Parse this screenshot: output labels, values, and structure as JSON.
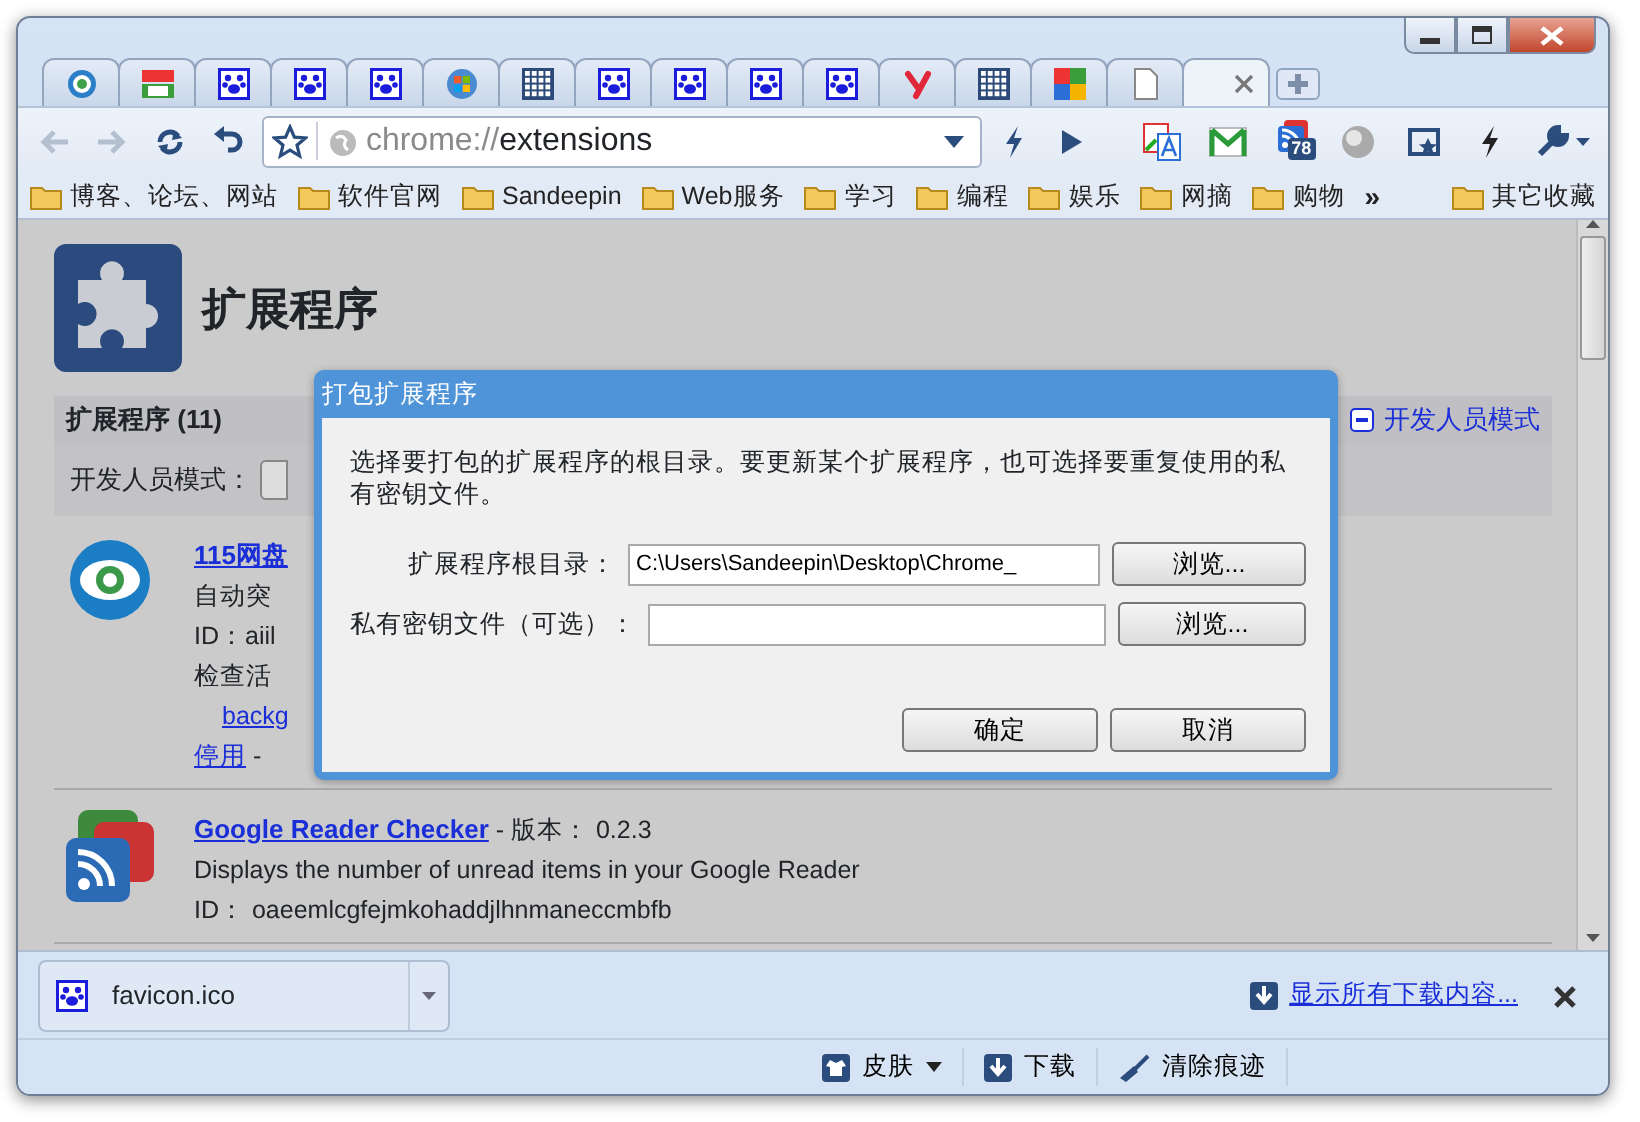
{
  "tabs": [
    {
      "kind": "ring",
      "selected": false
    },
    {
      "kind": "colorful",
      "selected": false
    },
    {
      "kind": "paw",
      "selected": false
    },
    {
      "kind": "paw",
      "selected": false
    },
    {
      "kind": "paw",
      "selected": false
    },
    {
      "kind": "windows",
      "selected": false
    },
    {
      "kind": "grid",
      "selected": false
    },
    {
      "kind": "paw",
      "selected": false
    },
    {
      "kind": "paw",
      "selected": false
    },
    {
      "kind": "paw",
      "selected": false
    },
    {
      "kind": "paw",
      "selected": false
    },
    {
      "kind": "y",
      "selected": false
    },
    {
      "kind": "grid",
      "selected": false
    },
    {
      "kind": "quad",
      "selected": false
    },
    {
      "kind": "page",
      "selected": false
    },
    {
      "kind": "none",
      "selected": true
    }
  ],
  "nav_buttons": [
    {
      "kind": "back",
      "disabled": true
    },
    {
      "kind": "forward",
      "disabled": true
    },
    {
      "kind": "reload",
      "disabled": false
    },
    {
      "kind": "undo",
      "disabled": false
    }
  ],
  "address": {
    "scheme": "chrome://",
    "path": "extensions"
  },
  "extension_buttons": [
    {
      "kind": "translate"
    },
    {
      "kind": "mail"
    },
    {
      "kind": "rss",
      "badge": "78"
    },
    {
      "kind": "globe"
    },
    {
      "kind": "star"
    },
    {
      "kind": "bolt"
    },
    {
      "kind": "wrench"
    }
  ],
  "bookmarks": [
    "博客、论坛、网站",
    "软件官网",
    "Sandeepin",
    "Web服务",
    "学习",
    "编程",
    "娱乐",
    "网摘",
    "购物"
  ],
  "bookmarks_overflow": "»",
  "other_bookmarks": "其它收藏",
  "page": {
    "title": "扩展程序",
    "section_title": "扩展程序 (11)",
    "dev_mode_link": "开发人员模式",
    "dev_mode_label": "开发人员模式：",
    "extensions": [
      {
        "kind": "eye",
        "name": "115网盘",
        "lines": [
          "自动突",
          "ID：aiil",
          "检查活"
        ],
        "view_link": "backg",
        "actions": [
          "停用",
          "-"
        ]
      },
      {
        "kind": "rss",
        "name": "Google Reader Checker",
        "meta": " - 版本： 0.2.3",
        "lines": [
          "Displays the number of unread items in your Google Reader",
          "ID： oaeemlcgfejmkohaddjlhnmaneccmbfb"
        ]
      }
    ]
  },
  "dialog": {
    "title": "打包扩展程序",
    "message": "选择要打包的扩展程序的根目录。要更新某个扩展程序，也可选择要重复使用的私有密钥文件。",
    "fields": [
      {
        "label": "扩展程序根目录：",
        "value": "C:\\Users\\Sandeepin\\Desktop\\Chrome_",
        "button": "浏览..."
      },
      {
        "label": "私有密钥文件（可选）：",
        "button": "浏览..."
      }
    ],
    "buttons": [
      "确定",
      "取消"
    ]
  },
  "download_shelf": {
    "items": [
      {
        "kind": "paw",
        "name": "favicon.ico"
      }
    ],
    "show_all": "显示所有下载内容..."
  },
  "status_bar": [
    {
      "kind": "shirt",
      "label": "皮肤",
      "dropdown": true
    },
    {
      "kind": "download",
      "label": "下载",
      "dropdown": false
    },
    {
      "kind": "broom",
      "label": "清除痕迹",
      "dropdown": false
    }
  ]
}
